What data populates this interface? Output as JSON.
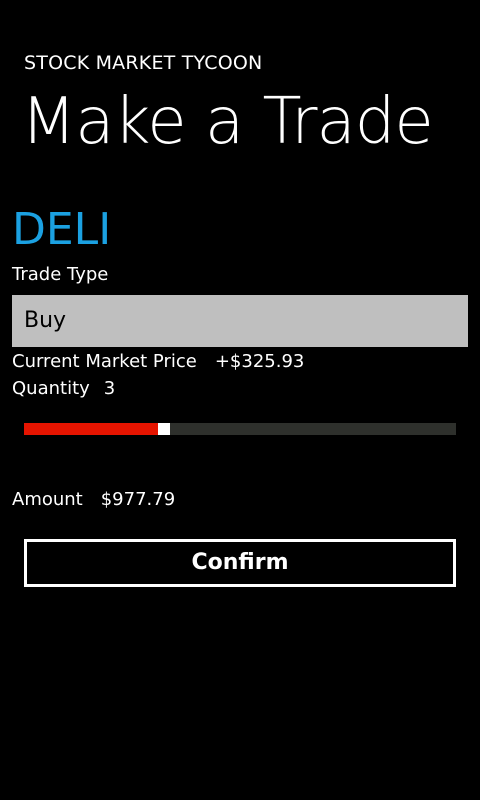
{
  "header": {
    "app_title": "STOCK MARKET TYCOON",
    "page_title": "Make a Trade"
  },
  "stock": {
    "symbol": "DELI",
    "symbol_color": "#1ba1e2"
  },
  "trade_type": {
    "label": "Trade Type",
    "selected": "Buy"
  },
  "price": {
    "label": "Current Market Price",
    "value": "+$325.93"
  },
  "quantity": {
    "label": "Quantity",
    "value": "3",
    "slider_fraction": 0.31,
    "fill_color": "#e51400",
    "track_color": "#2e302c"
  },
  "amount": {
    "label": "Amount",
    "value": "$977.79"
  },
  "actions": {
    "confirm_label": "Confirm"
  }
}
